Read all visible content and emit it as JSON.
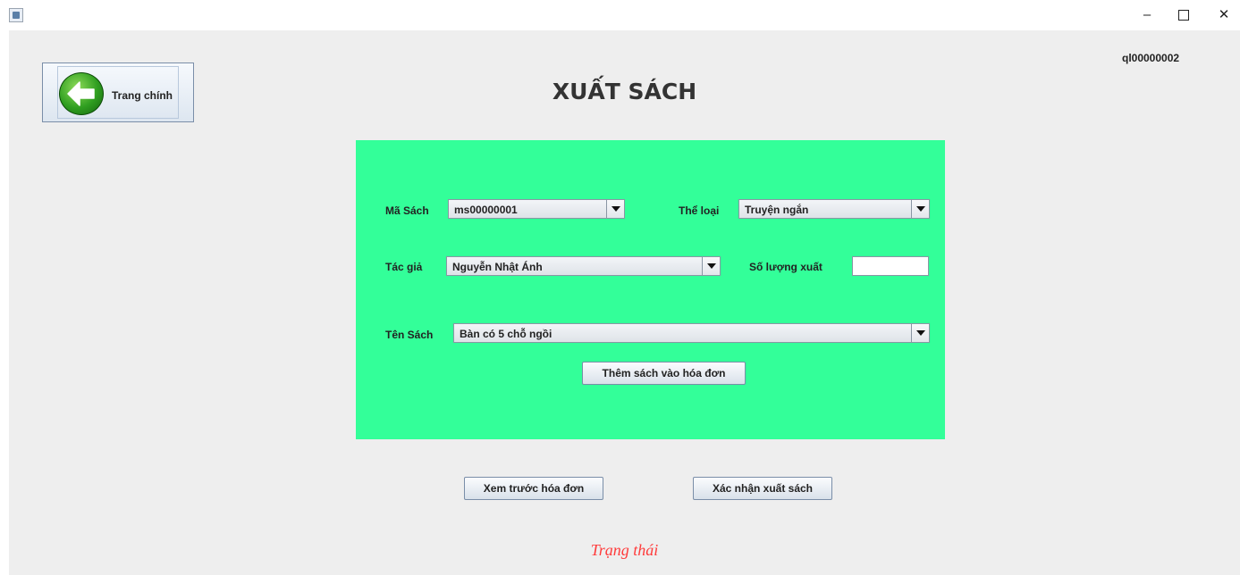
{
  "header": {
    "title": "XUẤT SÁCH",
    "user_id": "ql00000002",
    "back_label": "Trang chính"
  },
  "form": {
    "ma_sach": {
      "label": "Mã Sách",
      "value": "ms00000001"
    },
    "the_loai": {
      "label": "Thể loại",
      "value": "Truyện ngắn"
    },
    "tac_gia": {
      "label": "Tác giả",
      "value": "Nguyễn Nhật Ánh"
    },
    "so_luong": {
      "label": "Số lượng xuất",
      "value": ""
    },
    "ten_sach": {
      "label": "Tên Sách",
      "value": "Bàn có 5 chỗ ngồi"
    },
    "add_button": "Thêm sách vào hóa đơn"
  },
  "actions": {
    "preview_button": "Xem trước hóa đơn",
    "confirm_button": "Xác nhận xuất sách"
  },
  "status": "Trạng thái",
  "colors": {
    "panel": "#33ff99",
    "status": "#ff3b3b",
    "background": "#eeeeee"
  },
  "icons": [
    "app-icon",
    "back-arrow-icon",
    "dropdown-arrow-icon",
    "minimize-icon",
    "maximize-icon",
    "close-icon"
  ]
}
